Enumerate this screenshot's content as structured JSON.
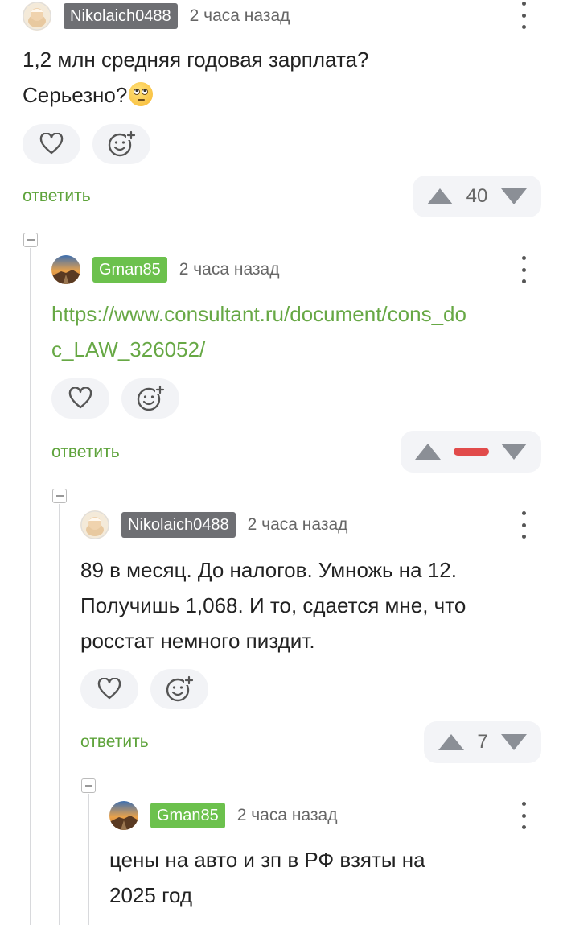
{
  "comments": [
    {
      "username": "Nikolaich0488",
      "time": "2 часа назад",
      "text_line1": "1,2 млн средняя годовая зарплата?",
      "text_line2": "Серьезно?",
      "reply_label": "ответить",
      "score": "40"
    },
    {
      "username": "Gman85",
      "time": "2 часа назад",
      "link_line1": "https://www.consultant.ru/document/cons_do",
      "link_line2": "c_LAW_326052/",
      "reply_label": "ответить",
      "score_state": "negative"
    },
    {
      "username": "Nikolaich0488",
      "time": "2 часа назад",
      "text_line1": "89 в месяц. До налогов. Умножь на 12.",
      "text_line2": "Получишь 1,068. И то, сдается мне, что",
      "text_line3": "росстат немного пиздит.",
      "reply_label": "ответить",
      "score": "7"
    },
    {
      "username": "Gman85",
      "time": "2 часа назад",
      "text_line1": "цены на авто и зп в РФ взяты на",
      "text_line2": "2025 год"
    }
  ],
  "colors": {
    "link_green": "#67a845",
    "badge_gray": "#6e6f73",
    "badge_green": "#6cc14d",
    "reply_green": "#5ea33b",
    "negative_red": "#e14b4b"
  },
  "icons": [
    "heart-icon",
    "add-reaction-icon",
    "upvote-icon",
    "downvote-icon",
    "more-options-icon",
    "collapse-icon",
    "rolling-eyes-emoji"
  ]
}
